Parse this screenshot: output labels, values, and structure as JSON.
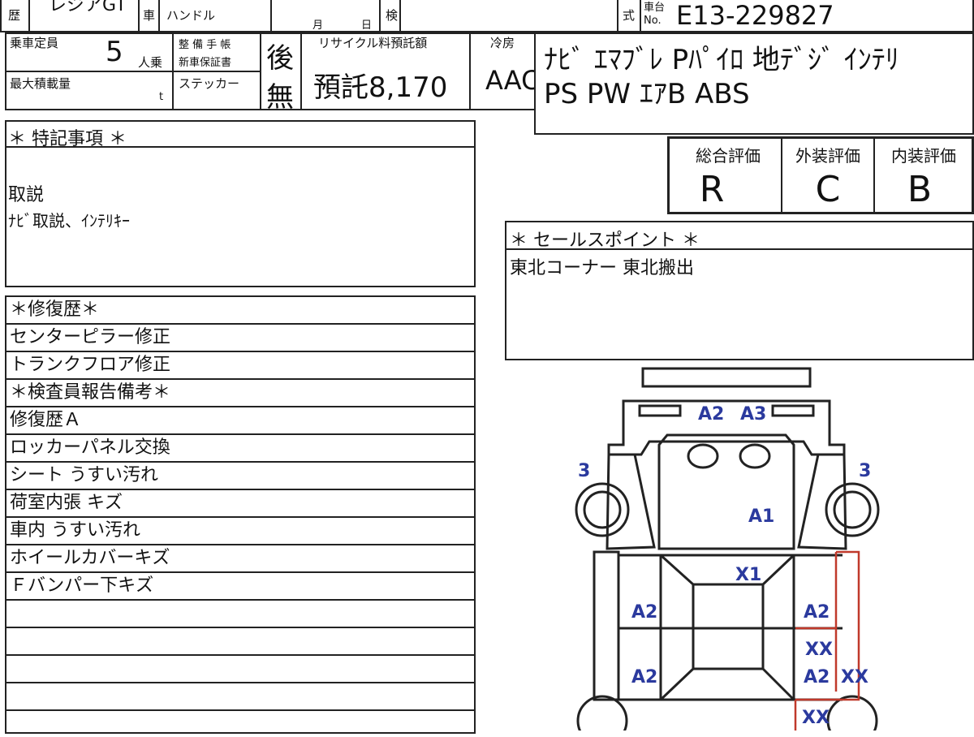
{
  "header": {
    "model_partial": "レジアGT",
    "label_reki": "歴",
    "label_kuruma": "車",
    "label_handle": "ハンドル",
    "label_month": "月",
    "label_day": "日",
    "label_ken": "検",
    "label_shiki": "式",
    "label_chassis": "車台",
    "label_no": "No.",
    "chassis_number": "E13-229827"
  },
  "specs": {
    "capacity_label": "乗車定員",
    "capacity_value": "5",
    "capacity_unit": "人乗",
    "max_load_label": "最大積載量",
    "max_load_unit": "t",
    "maintenance_label_1": "整 備 手 帳",
    "maintenance_label_2": "新車保証書",
    "maintenance_value": "後",
    "sticker_label": "ステッカー",
    "sticker_value": "無",
    "recycle_label": "リサイクル料預託額",
    "recycle_value": "預託8,170",
    "aircon_label": "冷房",
    "aircon_value": "AAC",
    "equipment_line1": "ﾅﾋﾞ ｴﾏﾌﾞﾚ Pﾊﾟｲﾛ 地ﾃﾞｼﾞ ｲﾝﾃﾘ",
    "equipment_line2": "PS PW ｴｱB ABS"
  },
  "grades": {
    "overall_label": "総合評価",
    "overall_value": "R",
    "exterior_label": "外装評価",
    "exterior_value": "C",
    "interior_label": "内装評価",
    "interior_value": "B"
  },
  "special_notes": {
    "title": "＊ 特記事項 ＊",
    "line1": "取説",
    "line2": "ﾅﾋﾞ取説、ｲﾝﾃﾘｷｰ"
  },
  "sales_point": {
    "title": "＊ セールスポイント ＊",
    "text": "東北コーナー 東北搬出"
  },
  "repair_list": [
    "＊修復歴＊",
    "センターピラー修正",
    "トランクフロア修正",
    "＊検査員報告備考＊",
    "修復歴Ａ",
    "ロッカーパネル交換",
    "シート うすい汚れ",
    "荷室内張 キズ",
    "車内 うすい汚れ",
    "ホイールカバーキズ",
    "Ｆバンパー下キズ",
    "",
    "",
    "",
    "",
    ""
  ],
  "diagram_marks": {
    "front_a2": "A2",
    "front_a3": "A3",
    "wheel_fl": "3",
    "wheel_fr": "3",
    "hood_a1": "A1",
    "center_x1": "X1",
    "left_a2_upper": "A2",
    "right_a2_upper": "A2",
    "right_xx_upper": "XX",
    "right_a2_lower": "A2",
    "right_xx_side": "XX",
    "left_a2_lower": "A2",
    "right_xx_lower": "XX"
  },
  "colors": {
    "mark_blue": "#2b3a9e",
    "line_red": "#c0392b"
  }
}
